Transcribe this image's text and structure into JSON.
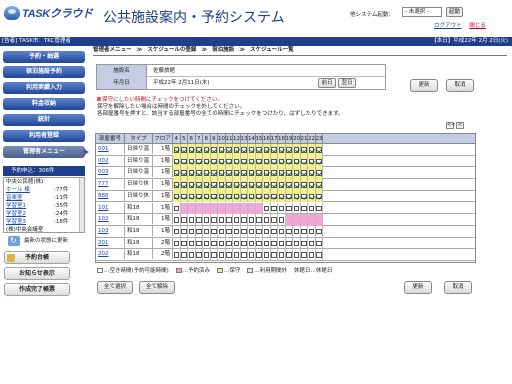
{
  "header": {
    "logo": "TASKクラウド",
    "title": "公共施設案内・予約システム",
    "system_label": "他システム起動：",
    "system_select": "- 未選択 -",
    "launch": "起動",
    "logout": "ログアウト",
    "close": "閉じる"
  },
  "userbar": {
    "left": "[告者] TASK市：TKC管理者",
    "right": "【本日】平成22年 2月 2日(火)"
  },
  "sidebar": {
    "nav": [
      "予約・抽選",
      "宿泊施設予約",
      "利用実績入力",
      "料金収納",
      "統計",
      "利用者登録",
      "管理者メニュー"
    ],
    "res_head": "予約申込：306件",
    "res_items": [
      {
        "name": "中央公民館(株)",
        "count": ""
      },
      {
        "name": "ホール 棟",
        "count": ":77件"
      },
      {
        "name": "音楽室",
        "count": ":11件"
      },
      {
        "name": "学習室1",
        "count": ":35件"
      },
      {
        "name": "学習室2",
        "count": ":24件"
      },
      {
        "name": "学習室3",
        "count": ":18件"
      },
      {
        "name": "(株)中央会議室",
        "count": ""
      }
    ],
    "refresh": "最新の状態に更新",
    "btn1": "予約台帳",
    "btn2": "お知らせ表示",
    "btn3": "作成完了帳票"
  },
  "crumb": [
    "管理者メニュー",
    "スケジュールの登録",
    "宿泊施設",
    "スケジュール一覧"
  ],
  "info": {
    "k1": "施設名",
    "v1": "佐藤旅館",
    "k2": "年月日",
    "v2": "平成22年 2月11日(木)",
    "prev": "前日",
    "next": "翌日"
  },
  "buttons": {
    "update": "更新",
    "cancel": "取消",
    "select_all": "全て選択",
    "clear_all": "全て解除"
  },
  "notes": [
    "保守にしたい時間にチェックをつけてください。",
    "保守を解除したい場合は時間のチェックを外してください。",
    "各部屋番号を押すと、該当する部屋番号の全ての時間にチェックをつけたり、はずしたりできます。"
  ],
  "pager": {
    "prev2": "<<",
    "prev": "<"
  },
  "grid": {
    "headers": {
      "room": "部屋番号",
      "type": "タイプ",
      "floor": "フロア"
    },
    "hours": [
      "4",
      "5",
      "6",
      "7",
      "8",
      "9",
      "10",
      "11",
      "12",
      "13",
      "14",
      "15",
      "16",
      "17",
      "18",
      "19",
      "20",
      "21",
      "22",
      "23"
    ],
    "rows": [
      {
        "room": "001",
        "type": "日帰り温",
        "floor": "1階",
        "cells": "YYYYYYYYYYYYYYYYYYYY"
      },
      {
        "room": "002",
        "type": "日帰り温",
        "floor": "1階",
        "cells": "YYYYYYYYYYYYYYYYYYYY"
      },
      {
        "room": "003",
        "type": "日帰り温",
        "floor": "1階",
        "cells": "YYYYYYYYYYYYYYYYYYYY"
      },
      {
        "room": "777",
        "type": "日帰り休",
        "floor": "1階",
        "cells": "YYYYYYYYYYYYYYYYYYYY"
      },
      {
        "room": "888",
        "type": "日帰り休",
        "floor": "1階",
        "cells": "YYYYYYYYYYYYYYYYYYYY"
      },
      {
        "room": "101",
        "type": "和18",
        "floor": "1階",
        "cells": "EPPPPPPPPPPPEEEEEEEE"
      },
      {
        "room": "102",
        "type": "和18",
        "floor": "1階",
        "cells": "EEEEEEEEEEEEEEEPPPPP"
      },
      {
        "room": "103",
        "type": "和18",
        "floor": "1階",
        "cells": "EEEEEEEEEEEEEEEEEEEE"
      },
      {
        "room": "201",
        "type": "和18",
        "floor": "2階",
        "cells": "EEEEEEEEEEEEEEEEEEEE"
      },
      {
        "room": "202",
        "type": "和18",
        "floor": "2階",
        "cells": "EEEEEEEEEEEEEEEEEEEE"
      }
    ]
  },
  "legend": {
    "empty": "空き時間(予約可能時間)",
    "booked": "予約済み",
    "maint": "保守",
    "outside": "利用期間外",
    "period_mark": "休館日",
    "holiday": "休館日"
  },
  "colors": {
    "nav": "#23479b",
    "header_bg": "#c4cde4",
    "checked": "#f5f18a",
    "booked": "#f2a7d6"
  }
}
